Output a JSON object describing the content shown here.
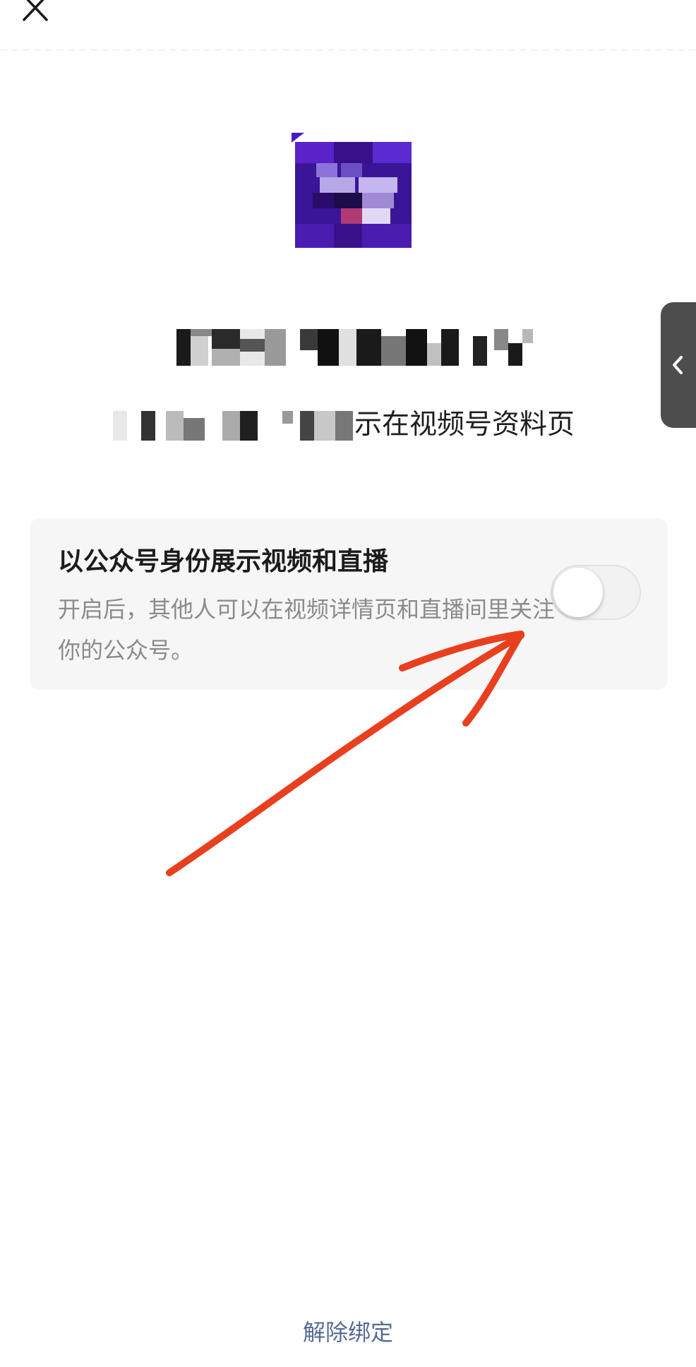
{
  "header": {
    "close_icon": "close-icon"
  },
  "profile": {
    "avatar_label": "avatar (pixelated)",
    "name_label": "name (pixelated)",
    "description_suffix": "示在视频号资料页"
  },
  "side_handle": {
    "icon": "chevron-left-icon"
  },
  "setting": {
    "title": "以公众号身份展示视频和直播",
    "description": "开启后，其他人可以在视频详情页和直播间里关注你的公众号。",
    "toggle_on": false
  },
  "footer": {
    "unbind_label": "解除绑定"
  },
  "colors": {
    "link": "#576b95",
    "annotation_arrow": "#e8401f",
    "card_bg": "#f6f6f6",
    "handle_bg": "#4d4d4d"
  }
}
